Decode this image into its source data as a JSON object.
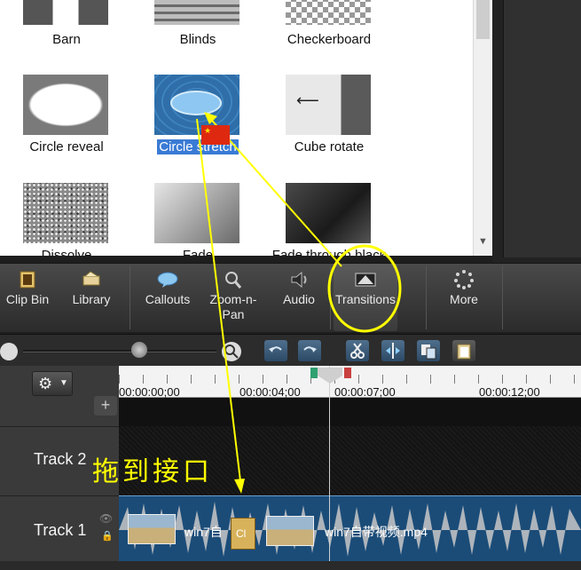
{
  "gallery": {
    "items": [
      {
        "label": "Barn",
        "icon": "barn-transition-thumb"
      },
      {
        "label": "Blinds",
        "icon": "blinds-transition-thumb"
      },
      {
        "label": "Checkerboard",
        "icon": "checkerboard-transition-thumb"
      },
      {
        "label": "Circle reveal",
        "icon": "circle-reveal-transition-thumb"
      },
      {
        "label": "Circle stretch",
        "icon": "circle-stretch-transition-thumb"
      },
      {
        "label": "Cube rotate",
        "icon": "cube-rotate-transition-thumb"
      },
      {
        "label": "Dissolve",
        "icon": "dissolve-transition-thumb"
      },
      {
        "label": "Fade",
        "icon": "fade-transition-thumb"
      },
      {
        "label": "Fade through black",
        "icon": "fade-through-black-transition-thumb"
      }
    ],
    "selected": "Circle stretch"
  },
  "toolbar": {
    "items": [
      {
        "label": "Clip Bin",
        "icon": "film-icon"
      },
      {
        "label": "Library",
        "icon": "library-icon"
      },
      {
        "label": "Callouts",
        "icon": "callout-icon"
      },
      {
        "label": "Zoom-n-\nPan",
        "icon": "magnifier-icon"
      },
      {
        "label": "Audio",
        "icon": "speaker-icon"
      },
      {
        "label": "Transitions",
        "icon": "transitions-icon"
      },
      {
        "label": "More",
        "icon": "more-icon"
      }
    ]
  },
  "timeline": {
    "ticks": [
      "00:00:00;00",
      "00:00:04;00",
      "00:00:07;00",
      "00:00:12;00"
    ],
    "tracks": [
      "Track 2",
      "Track 1"
    ],
    "clips": [
      {
        "label": "win7自"
      },
      {
        "label": "Cl"
      },
      {
        "label": "win7自带视频.mp4"
      }
    ]
  },
  "annotation": {
    "text": "拖到接口",
    "color": "#ffff00"
  },
  "colors": {
    "selection": "#3a7bd5",
    "clip": "#1b4c78",
    "highlight": "#ffff00"
  }
}
